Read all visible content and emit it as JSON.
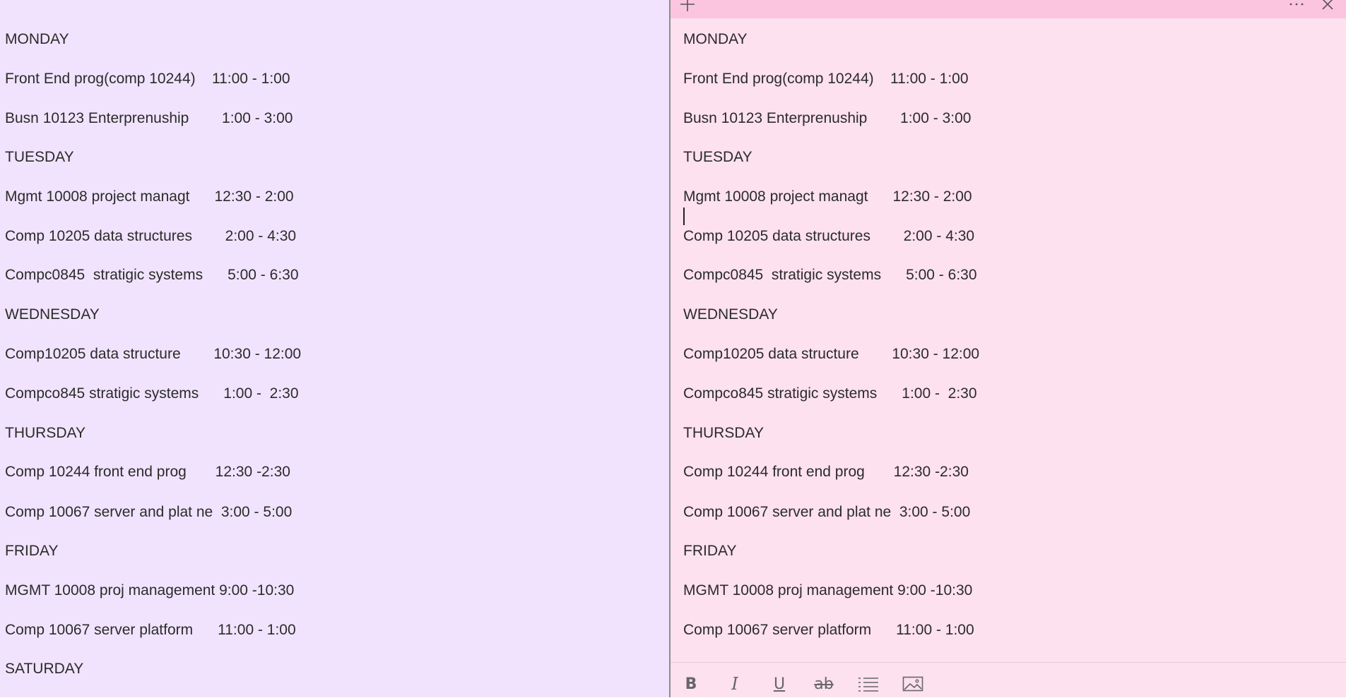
{
  "notes_content": {
    "lines": [
      "MONDAY",
      "Front End prog(comp 10244)    11:00 - 1:00",
      "Busn 10123 Enterprenuship        1:00 - 3:00",
      "TUESDAY",
      "Mgmt 10008 project managt      12:30 - 2:00",
      "Comp 10205 data structures        2:00 - 4:30",
      "Compc0845  stratigic systems      5:00 - 6:30",
      "WEDNESDAY",
      "Comp10205 data structure        10:30 - 12:00",
      "Compco845 stratigic systems      1:00 -  2:30",
      "THURSDAY",
      "Comp 10244 front end prog       12:30 -2:30",
      "Comp 10067 server and plat ne  3:00 - 5:00",
      "FRIDAY",
      "MGMT 10008 proj management 9:00 -10:30",
      "Comp 10067 server platform      11:00 - 1:00",
      "SATURDAY"
    ]
  },
  "title_bar": {
    "new_note_icon": "plus-icon",
    "menu_icon": "more-icon",
    "close_icon": "close-icon"
  },
  "toolbar": {
    "bold_label": "B",
    "italic_label": "I",
    "underline_label": "U",
    "strikethrough_label": "ab",
    "icons": [
      "bold-icon",
      "italic-icon",
      "underline-icon",
      "strikethrough-icon",
      "bullet-list-icon",
      "image-icon"
    ]
  },
  "colors": {
    "left_note_bg": "#f1e3fd",
    "right_note_bg": "#fde1ee",
    "right_title_bar": "#fbc5df",
    "text": "#2b2b2b"
  }
}
